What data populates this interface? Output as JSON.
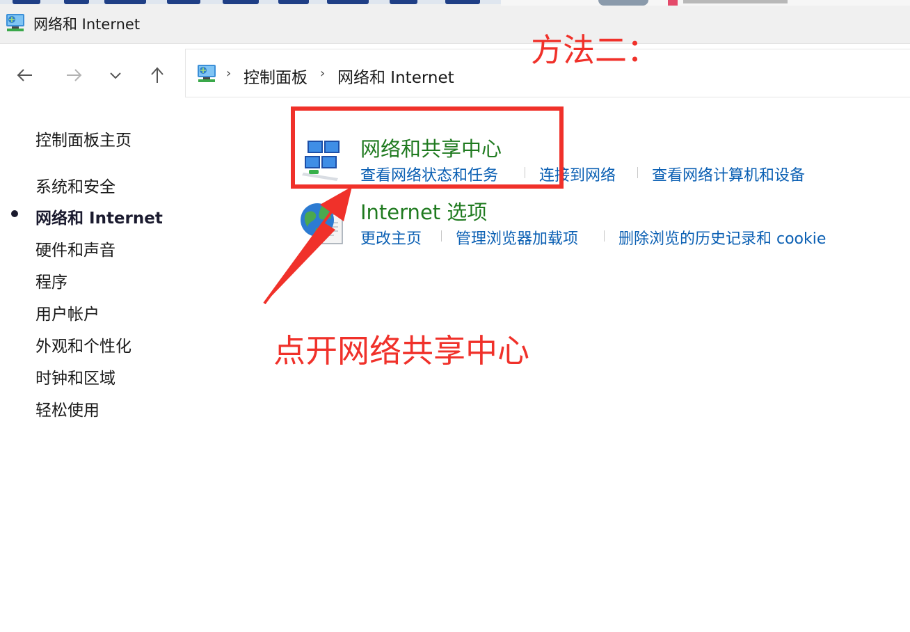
{
  "window": {
    "title": "网络和 Internet"
  },
  "nav": {
    "back_icon": "arrow-left-icon",
    "forward_icon": "arrow-right-icon",
    "recent_icon": "chevron-down-icon",
    "up_icon": "arrow-up-icon"
  },
  "breadcrumb": {
    "items": [
      "控制面板",
      "网络和 Internet"
    ]
  },
  "sidebar": {
    "items": [
      {
        "label": "控制面板主页",
        "active": false
      },
      {
        "label": "系统和安全",
        "active": false
      },
      {
        "label": "网络和 Internet",
        "active": true
      },
      {
        "label": "硬件和声音",
        "active": false
      },
      {
        "label": "程序",
        "active": false
      },
      {
        "label": "用户帐户",
        "active": false
      },
      {
        "label": "外观和个性化",
        "active": false
      },
      {
        "label": "时钟和区域",
        "active": false
      },
      {
        "label": "轻松使用",
        "active": false
      }
    ]
  },
  "categories": [
    {
      "title": "网络和共享中心",
      "icon": "network-sharing-center-icon",
      "links": [
        "查看网络状态和任务",
        "连接到网络",
        "查看网络计算机和设备"
      ]
    },
    {
      "title": "Internet 选项",
      "icon": "internet-options-icon",
      "links": [
        "更改主页",
        "管理浏览器加载项",
        "删除浏览的历史记录和 cookie"
      ]
    }
  ],
  "annotations": {
    "method_label": "方法二：",
    "instruction": "点开网络共享中心"
  },
  "colors": {
    "category_title": "#1f7a1f",
    "link": "#0a5fb3",
    "annotation": "#f0312a"
  }
}
